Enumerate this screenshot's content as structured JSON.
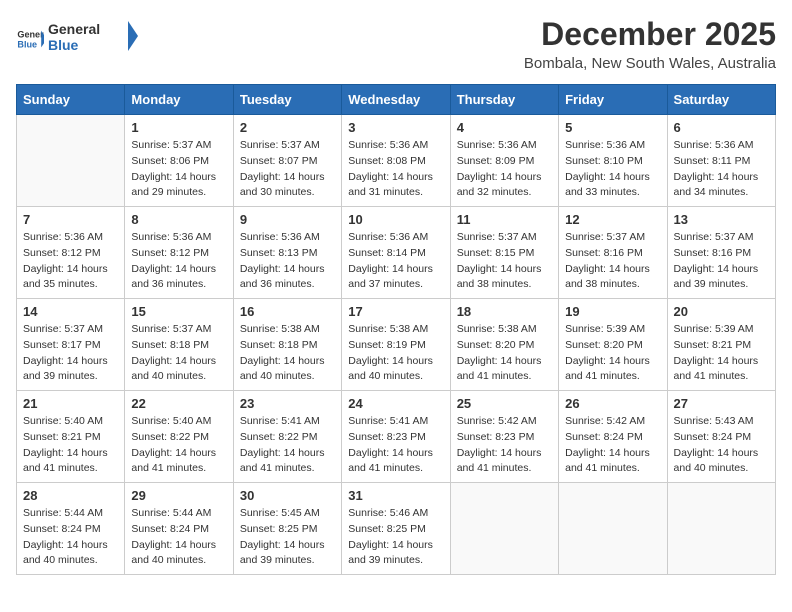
{
  "header": {
    "logo_general": "General",
    "logo_blue": "Blue",
    "title": "December 2025",
    "subtitle": "Bombala, New South Wales, Australia"
  },
  "days_of_week": [
    "Sunday",
    "Monday",
    "Tuesday",
    "Wednesday",
    "Thursday",
    "Friday",
    "Saturday"
  ],
  "weeks": [
    [
      {
        "day": "",
        "info": ""
      },
      {
        "day": "1",
        "info": "Sunrise: 5:37 AM\nSunset: 8:06 PM\nDaylight: 14 hours\nand 29 minutes."
      },
      {
        "day": "2",
        "info": "Sunrise: 5:37 AM\nSunset: 8:07 PM\nDaylight: 14 hours\nand 30 minutes."
      },
      {
        "day": "3",
        "info": "Sunrise: 5:36 AM\nSunset: 8:08 PM\nDaylight: 14 hours\nand 31 minutes."
      },
      {
        "day": "4",
        "info": "Sunrise: 5:36 AM\nSunset: 8:09 PM\nDaylight: 14 hours\nand 32 minutes."
      },
      {
        "day": "5",
        "info": "Sunrise: 5:36 AM\nSunset: 8:10 PM\nDaylight: 14 hours\nand 33 minutes."
      },
      {
        "day": "6",
        "info": "Sunrise: 5:36 AM\nSunset: 8:11 PM\nDaylight: 14 hours\nand 34 minutes."
      }
    ],
    [
      {
        "day": "7",
        "info": "Sunrise: 5:36 AM\nSunset: 8:12 PM\nDaylight: 14 hours\nand 35 minutes."
      },
      {
        "day": "8",
        "info": "Sunrise: 5:36 AM\nSunset: 8:12 PM\nDaylight: 14 hours\nand 36 minutes."
      },
      {
        "day": "9",
        "info": "Sunrise: 5:36 AM\nSunset: 8:13 PM\nDaylight: 14 hours\nand 36 minutes."
      },
      {
        "day": "10",
        "info": "Sunrise: 5:36 AM\nSunset: 8:14 PM\nDaylight: 14 hours\nand 37 minutes."
      },
      {
        "day": "11",
        "info": "Sunrise: 5:37 AM\nSunset: 8:15 PM\nDaylight: 14 hours\nand 38 minutes."
      },
      {
        "day": "12",
        "info": "Sunrise: 5:37 AM\nSunset: 8:16 PM\nDaylight: 14 hours\nand 38 minutes."
      },
      {
        "day": "13",
        "info": "Sunrise: 5:37 AM\nSunset: 8:16 PM\nDaylight: 14 hours\nand 39 minutes."
      }
    ],
    [
      {
        "day": "14",
        "info": "Sunrise: 5:37 AM\nSunset: 8:17 PM\nDaylight: 14 hours\nand 39 minutes."
      },
      {
        "day": "15",
        "info": "Sunrise: 5:37 AM\nSunset: 8:18 PM\nDaylight: 14 hours\nand 40 minutes."
      },
      {
        "day": "16",
        "info": "Sunrise: 5:38 AM\nSunset: 8:18 PM\nDaylight: 14 hours\nand 40 minutes."
      },
      {
        "day": "17",
        "info": "Sunrise: 5:38 AM\nSunset: 8:19 PM\nDaylight: 14 hours\nand 40 minutes."
      },
      {
        "day": "18",
        "info": "Sunrise: 5:38 AM\nSunset: 8:20 PM\nDaylight: 14 hours\nand 41 minutes."
      },
      {
        "day": "19",
        "info": "Sunrise: 5:39 AM\nSunset: 8:20 PM\nDaylight: 14 hours\nand 41 minutes."
      },
      {
        "day": "20",
        "info": "Sunrise: 5:39 AM\nSunset: 8:21 PM\nDaylight: 14 hours\nand 41 minutes."
      }
    ],
    [
      {
        "day": "21",
        "info": "Sunrise: 5:40 AM\nSunset: 8:21 PM\nDaylight: 14 hours\nand 41 minutes."
      },
      {
        "day": "22",
        "info": "Sunrise: 5:40 AM\nSunset: 8:22 PM\nDaylight: 14 hours\nand 41 minutes."
      },
      {
        "day": "23",
        "info": "Sunrise: 5:41 AM\nSunset: 8:22 PM\nDaylight: 14 hours\nand 41 minutes."
      },
      {
        "day": "24",
        "info": "Sunrise: 5:41 AM\nSunset: 8:23 PM\nDaylight: 14 hours\nand 41 minutes."
      },
      {
        "day": "25",
        "info": "Sunrise: 5:42 AM\nSunset: 8:23 PM\nDaylight: 14 hours\nand 41 minutes."
      },
      {
        "day": "26",
        "info": "Sunrise: 5:42 AM\nSunset: 8:24 PM\nDaylight: 14 hours\nand 41 minutes."
      },
      {
        "day": "27",
        "info": "Sunrise: 5:43 AM\nSunset: 8:24 PM\nDaylight: 14 hours\nand 40 minutes."
      }
    ],
    [
      {
        "day": "28",
        "info": "Sunrise: 5:44 AM\nSunset: 8:24 PM\nDaylight: 14 hours\nand 40 minutes."
      },
      {
        "day": "29",
        "info": "Sunrise: 5:44 AM\nSunset: 8:24 PM\nDaylight: 14 hours\nand 40 minutes."
      },
      {
        "day": "30",
        "info": "Sunrise: 5:45 AM\nSunset: 8:25 PM\nDaylight: 14 hours\nand 39 minutes."
      },
      {
        "day": "31",
        "info": "Sunrise: 5:46 AM\nSunset: 8:25 PM\nDaylight: 14 hours\nand 39 minutes."
      },
      {
        "day": "",
        "info": ""
      },
      {
        "day": "",
        "info": ""
      },
      {
        "day": "",
        "info": ""
      }
    ]
  ]
}
